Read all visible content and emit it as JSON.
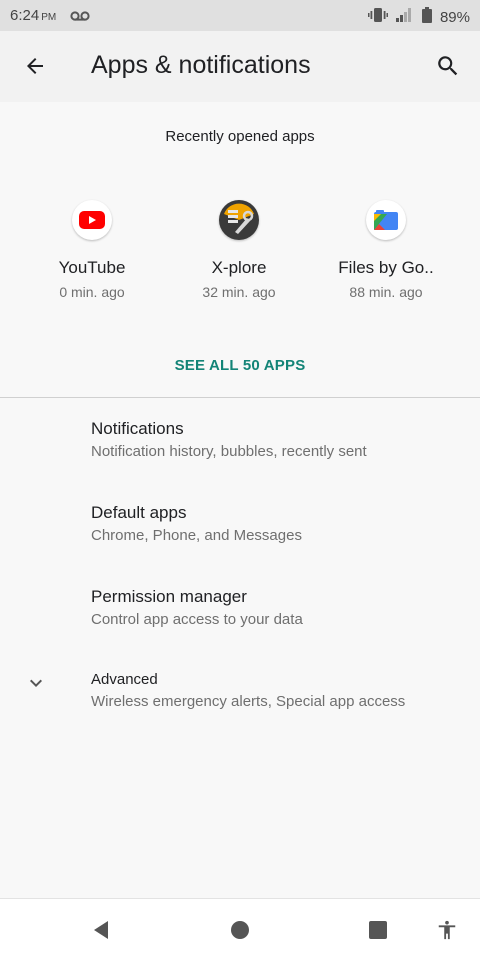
{
  "status": {
    "time": "6:24",
    "ampm": "PM",
    "battery": "89%"
  },
  "appbar": {
    "title": "Apps & notifications"
  },
  "recent": {
    "header": "Recently opened apps",
    "apps": [
      {
        "name": "YouTube",
        "time": "0 min. ago",
        "icon": "youtube-icon"
      },
      {
        "name": "X-plore",
        "time": "32 min. ago",
        "icon": "xplore-icon"
      },
      {
        "name": "Files by Go..",
        "time": "88 min. ago",
        "icon": "files-by-google-icon"
      }
    ],
    "see_all": "SEE ALL 50 APPS"
  },
  "settings": [
    {
      "title": "Notifications",
      "subtitle": "Notification history, bubbles, recently sent"
    },
    {
      "title": "Default apps",
      "subtitle": "Chrome, Phone, and Messages"
    },
    {
      "title": "Permission manager",
      "subtitle": "Control app access to your data"
    },
    {
      "title": "Advanced",
      "subtitle": "Wireless emergency alerts, Special app access"
    }
  ],
  "colors": {
    "accent": "#138477",
    "youtube_red": "#ff0000"
  }
}
